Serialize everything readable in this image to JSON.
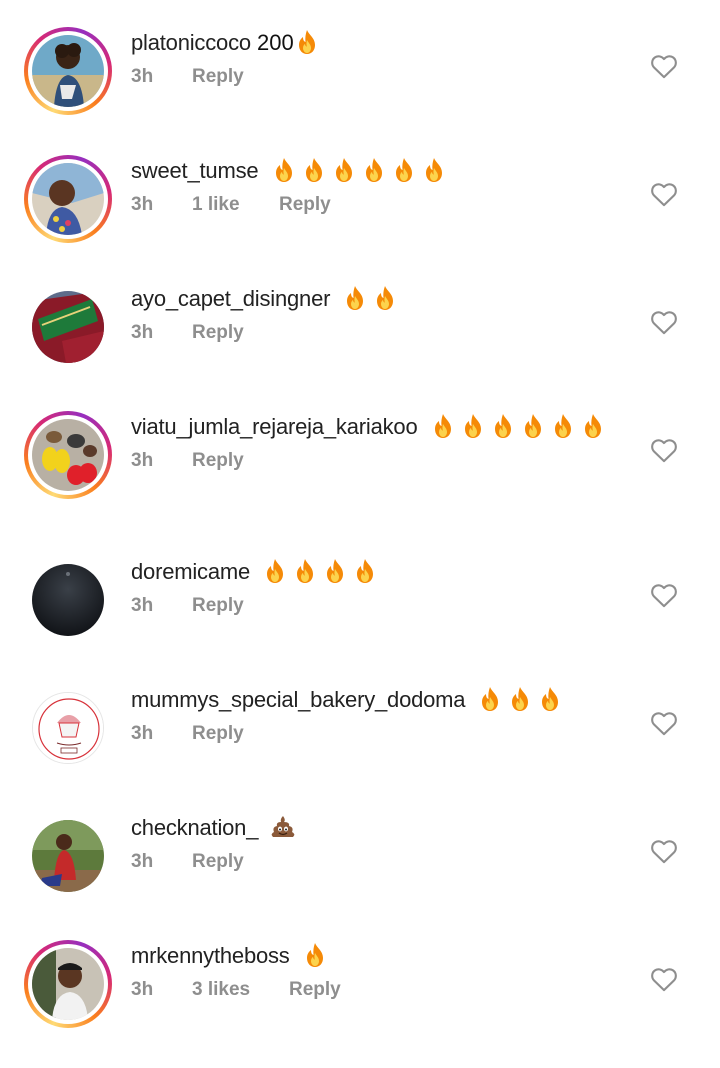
{
  "comments": [
    {
      "username": "platoniccoco",
      "text": "200",
      "fires": 1,
      "time": "3h",
      "likes": "",
      "reply": "Reply",
      "story_ring": true,
      "avatar": "avatar-person-coast"
    },
    {
      "username": "sweet_tumse",
      "text": "",
      "fires": 6,
      "time": "3h",
      "likes": "1 like",
      "reply": "Reply",
      "story_ring": true,
      "avatar": "avatar-person-selfie"
    },
    {
      "username": "ayo_capet_disingner",
      "text": "",
      "fires": 2,
      "time": "3h",
      "likes": "",
      "reply": "Reply",
      "story_ring": false,
      "avatar": "avatar-carpet"
    },
    {
      "username": "viatu_jumla_rejareja_kariakoo",
      "text": "",
      "fires": 6,
      "time": "3h",
      "likes": "",
      "reply": "Reply",
      "story_ring": true,
      "avatar": "avatar-sandals"
    },
    {
      "username": "doremicame",
      "text": "",
      "fires": 4,
      "time": "3h",
      "likes": "",
      "reply": "Reply",
      "story_ring": false,
      "avatar": "avatar-dark"
    },
    {
      "username": "mummys_special_bakery_dodoma",
      "text": "",
      "fires": 3,
      "time": "3h",
      "likes": "",
      "reply": "Reply",
      "story_ring": false,
      "avatar": "avatar-bakery-logo"
    },
    {
      "username": "checknation_",
      "text": "💩",
      "fires": 0,
      "time": "3h",
      "likes": "",
      "reply": "Reply",
      "story_ring": false,
      "avatar": "avatar-person-outdoor"
    },
    {
      "username": "mrkennytheboss",
      "text": "",
      "fires": 1,
      "time": "3h",
      "likes": "3 likes",
      "reply": "Reply",
      "story_ring": true,
      "avatar": "avatar-person-portrait"
    }
  ],
  "colors": {
    "meta_gray": "#8e8e8e",
    "username": "#222222",
    "fire": "#f58a07"
  },
  "icons": {
    "like": "heart-outline-icon",
    "fire": "fire-emoji-icon",
    "poop": "pile-of-poo-emoji-icon"
  }
}
